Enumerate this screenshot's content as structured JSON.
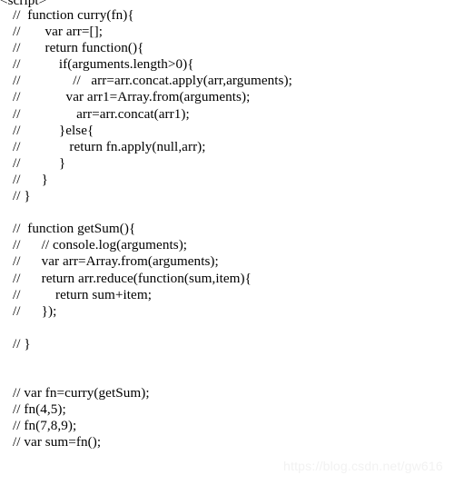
{
  "document": {
    "language": "javascript",
    "background_color": "#ffffff",
    "text_color": "#000000",
    "lines": [
      {
        "id": "line-1",
        "text": "<script>",
        "clipped": true,
        "indented": false
      },
      {
        "id": "line-2",
        "text": "//  function curry(fn){",
        "clipped": false,
        "indented": true
      },
      {
        "id": "line-3",
        "text": "//       var arr=[];",
        "clipped": false,
        "indented": true
      },
      {
        "id": "line-4",
        "text": "//       return function(){",
        "clipped": false,
        "indented": true
      },
      {
        "id": "line-5",
        "text": "//           if(arguments.length>0){",
        "clipped": false,
        "indented": true
      },
      {
        "id": "line-6",
        "text": "//               //   arr=arr.concat.apply(arr,arguments);",
        "clipped": false,
        "indented": true
      },
      {
        "id": "line-7",
        "text": "//             var arr1=Array.from(arguments);",
        "clipped": false,
        "indented": true
      },
      {
        "id": "line-8",
        "text": "//                arr=arr.concat(arr1);",
        "clipped": false,
        "indented": true
      },
      {
        "id": "line-9",
        "text": "//           }else{",
        "clipped": false,
        "indented": true
      },
      {
        "id": "line-10",
        "text": "//              return fn.apply(null,arr);",
        "clipped": false,
        "indented": true
      },
      {
        "id": "line-11",
        "text": "//           }",
        "clipped": false,
        "indented": true
      },
      {
        "id": "line-12",
        "text": "//      }",
        "clipped": false,
        "indented": true
      },
      {
        "id": "line-13",
        "text": "// }",
        "clipped": false,
        "indented": true
      },
      {
        "id": "line-14",
        "text": " ",
        "clipped": false,
        "indented": true
      },
      {
        "id": "line-15",
        "text": "//  function getSum(){",
        "clipped": false,
        "indented": true
      },
      {
        "id": "line-16",
        "text": "//      // console.log(arguments);",
        "clipped": false,
        "indented": true
      },
      {
        "id": "line-17",
        "text": "//      var arr=Array.from(arguments);",
        "clipped": false,
        "indented": true
      },
      {
        "id": "line-18",
        "text": "//      return arr.reduce(function(sum,item){",
        "clipped": false,
        "indented": true
      },
      {
        "id": "line-19",
        "text": "//          return sum+item;",
        "clipped": false,
        "indented": true
      },
      {
        "id": "line-20",
        "text": "//      });",
        "clipped": false,
        "indented": true
      },
      {
        "id": "line-21",
        "text": " ",
        "clipped": false,
        "indented": true
      },
      {
        "id": "line-22",
        "text": "// }",
        "clipped": false,
        "indented": true
      },
      {
        "id": "line-23",
        "text": " ",
        "clipped": false,
        "indented": true
      },
      {
        "id": "line-24",
        "text": " ",
        "clipped": false,
        "indented": true
      },
      {
        "id": "line-25",
        "text": "// var fn=curry(getSum);",
        "clipped": false,
        "indented": true
      },
      {
        "id": "line-26",
        "text": "// fn(4,5);",
        "clipped": false,
        "indented": true
      },
      {
        "id": "line-27",
        "text": "// fn(7,8,9);",
        "clipped": false,
        "indented": true
      },
      {
        "id": "line-28",
        "text": "// var sum=fn();",
        "clipped": false,
        "indented": true
      }
    ]
  },
  "watermark": {
    "text": "https://blog.csdn.net/gw616",
    "color": "#f2f2f2"
  }
}
